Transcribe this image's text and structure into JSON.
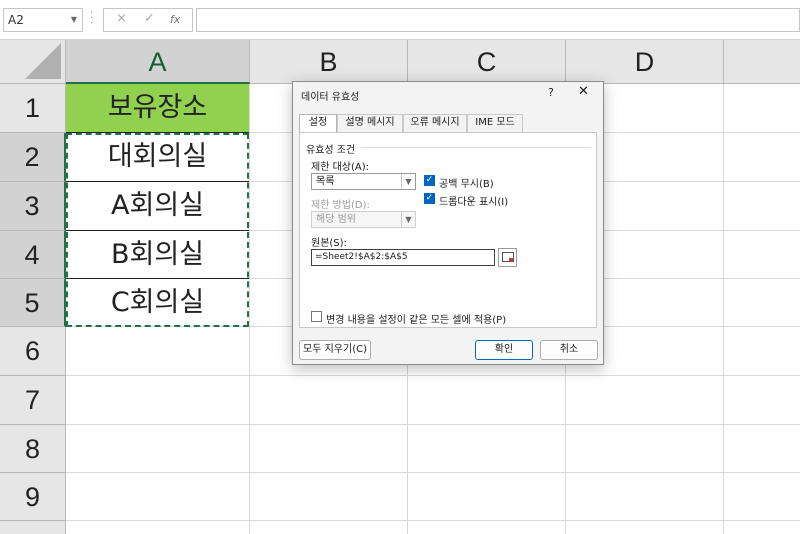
{
  "formula_bar": {
    "name_box": "A2",
    "cancel_icon": "×",
    "enter_icon": "✓",
    "function_icon": "fx",
    "formula": ""
  },
  "columns": [
    "A",
    "B",
    "C",
    "D"
  ],
  "rows": [
    "1",
    "2",
    "3",
    "4",
    "5",
    "6",
    "7",
    "8",
    "9"
  ],
  "cells": {
    "A1": "보유장소",
    "A2": "대회의실",
    "A3": "A회의실",
    "A4": "B회의실",
    "A5": "C회의실"
  },
  "colors": {
    "header_fill": "#92d050",
    "selection": "#217346",
    "accent": "#0067c0"
  },
  "dialog": {
    "title": "데이터 유효성",
    "help": "?",
    "close": "✕",
    "tabs": [
      "설정",
      "설명 메시지",
      "오류 메시지",
      "IME 모드"
    ],
    "active_tab": "설정",
    "group_label": "유효성 조건",
    "allow_label": "제한 대상(A):",
    "allow_value": "목록",
    "data_label": "제한 방법(D):",
    "data_value": "해당 범위",
    "ignore_blank": {
      "label": "공백 무시(B)",
      "checked": true
    },
    "dropdown": {
      "label": "드롭다운 표시(I)",
      "checked": true
    },
    "source_label": "원본(S):",
    "source_value": "=Sheet2!$A$2:$A$5",
    "apply_all": {
      "label": "변경 내용을 설정이 같은 모든 셀에 적용(P)",
      "checked": false
    },
    "clear_button": "모두 지우기(C)",
    "ok_button": "확인",
    "cancel_button": "취소"
  }
}
